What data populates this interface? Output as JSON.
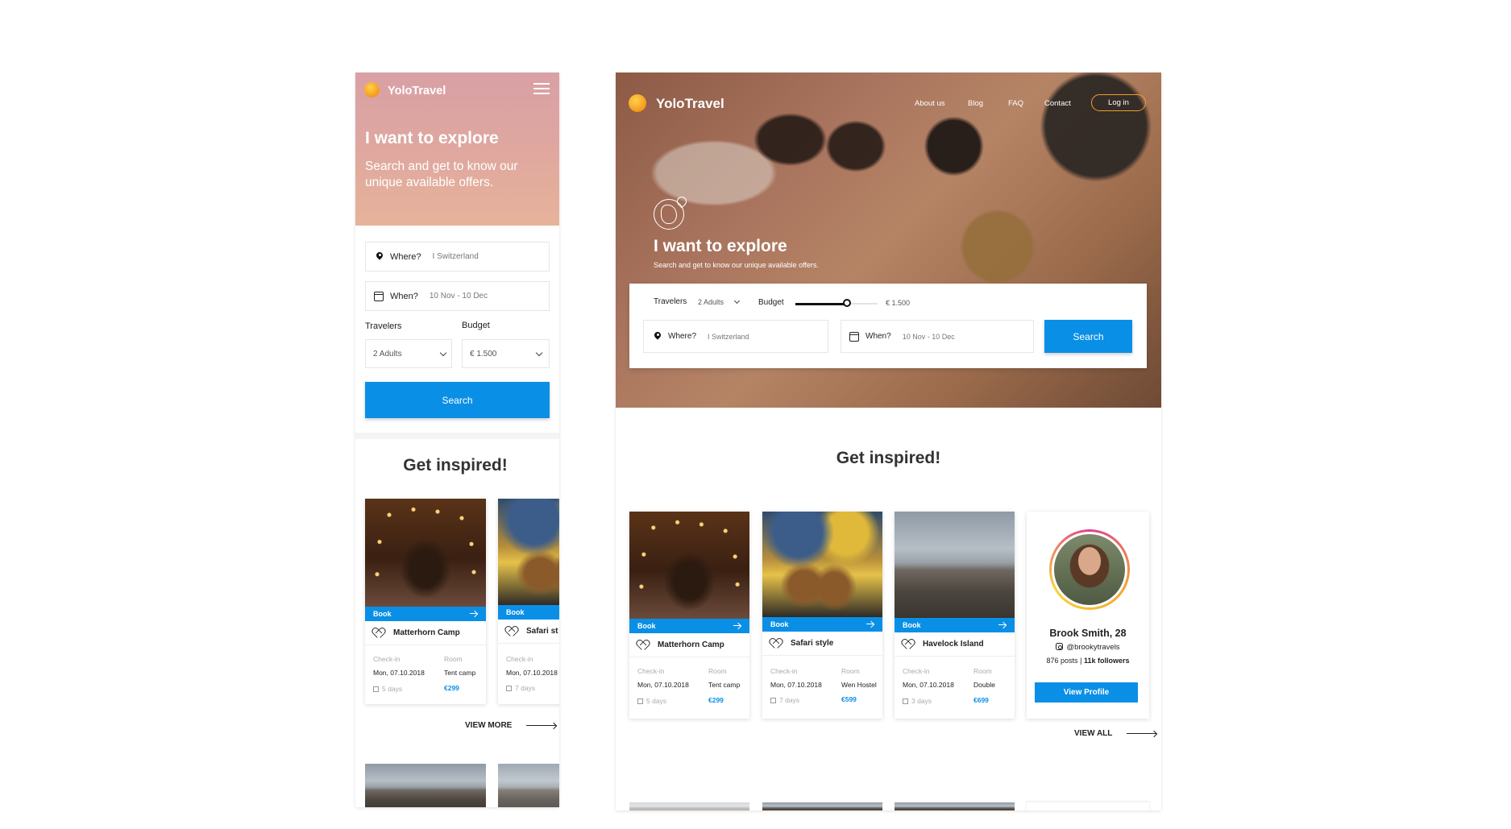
{
  "brand": {
    "name": "YoloTravel"
  },
  "colors": {
    "accent": "#0a8fe6",
    "login_border": "#f0a028"
  },
  "hero": {
    "title": "I want to explore",
    "subtitle": "Search and get to know our unique available offers."
  },
  "search": {
    "where_label": "Where?",
    "where_value": "I Switzerland",
    "when_label": "When?",
    "when_value": "10 Nov - 10 Dec",
    "travelers_label": "Travelers",
    "travelers_value": "2 Adults",
    "budget_label": "Budget",
    "budget_value": "€ 1.500",
    "budget_level": 0.63,
    "button": "Search"
  },
  "nav": {
    "about": "About us",
    "blog": "Blog",
    "faq": "FAQ",
    "contact": "Contact",
    "login": "Log in"
  },
  "inspired": {
    "title": "Get inspired!",
    "view_more": "VIEW MORE",
    "view_all": "VIEW ALL"
  },
  "card_labels": {
    "book": "Book",
    "checkin": "Check-in",
    "room": "Room"
  },
  "cards": [
    {
      "name": "Matterhorn Camp",
      "date": "Mon, 07.10.2018",
      "room": "Tent camp",
      "duration": "5 days",
      "price": "€299"
    },
    {
      "name": "Safari style",
      "date": "Mon, 07.10.2018",
      "room": "Wen Hostel",
      "duration": "7 days",
      "price": "€599"
    },
    {
      "name": "Havelock Island",
      "date": "Mon, 07.10.2018",
      "room": "Double",
      "duration": "3 days",
      "price": "€699"
    }
  ],
  "mobile_second_card": {
    "name": "Safari st"
  },
  "profile": {
    "name": "Brook Smith, 28",
    "handle": "@brookytravels",
    "posts": "876 posts",
    "separator": "|",
    "followers": "11k followers",
    "button": "View Profile"
  },
  "icons": [
    "logo-sun-icon",
    "menu-icon",
    "location-pin-icon",
    "calendar-icon",
    "chevron-down-icon",
    "heart-icon",
    "arrow-right-icon",
    "globe-pin-icon",
    "instagram-icon"
  ]
}
